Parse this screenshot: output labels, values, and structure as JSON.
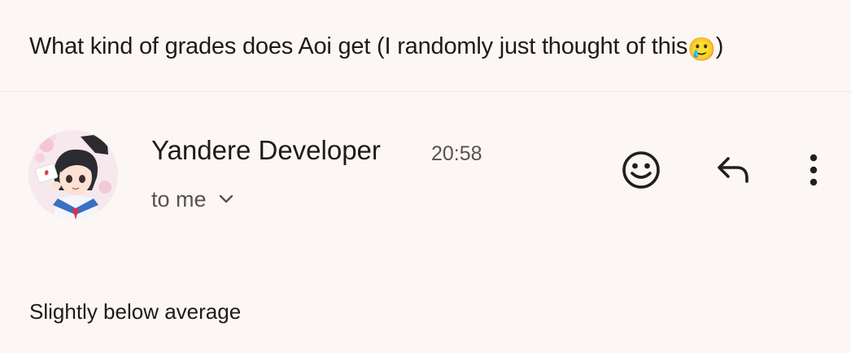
{
  "previous_message": {
    "body": "What kind of grades does Aoi get (I randomly just thought of this",
    "emoji": "🥲",
    "closing": ")"
  },
  "message": {
    "sender": "Yandere Developer",
    "time": "20:58",
    "recipient_label": "to me",
    "body": "Slightly below average"
  },
  "icons": {
    "recipients_toggle": "chevron-down-icon",
    "react": "add-reaction-icon",
    "reply": "reply-icon",
    "more": "more-vert-icon",
    "avatar": "sender-avatar"
  },
  "colors": {
    "background": "#fcf7f4",
    "text_primary": "#1d1b1a",
    "text_secondary": "#58524e",
    "divider": "#ece7e3"
  }
}
